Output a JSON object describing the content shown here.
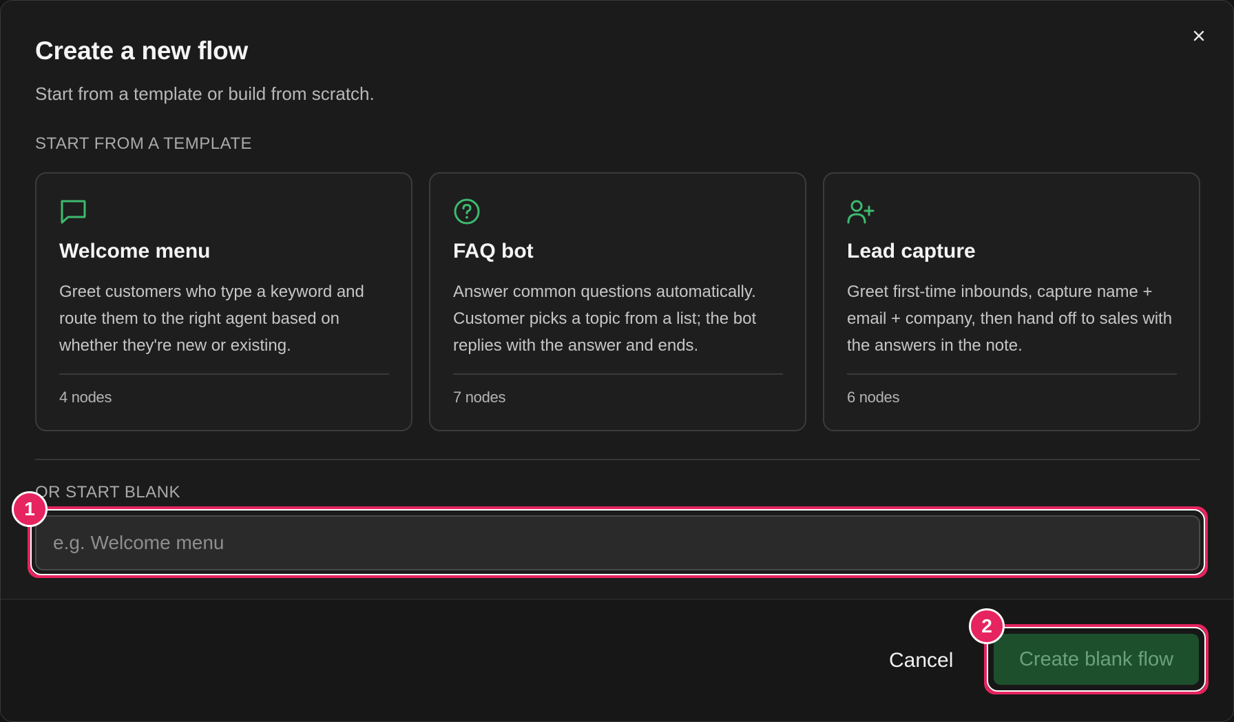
{
  "dialog": {
    "title": "Create a new flow",
    "subtitle": "Start from a template or build from scratch.",
    "close_icon": "close-icon"
  },
  "templates": {
    "section_label": "START FROM A TEMPLATE",
    "accent_color": "#3dbb6e",
    "cards": [
      {
        "icon": "message-square-icon",
        "name": "Welcome menu",
        "description": "Greet customers who type a keyword and route them to the right agent based on whether they're new or existing.",
        "nodes": "4 nodes"
      },
      {
        "icon": "help-circle-icon",
        "name": "FAQ bot",
        "description": "Answer common questions automatically. Customer picks a topic from a list; the bot replies with the answer and ends.",
        "nodes": "7 nodes"
      },
      {
        "icon": "user-plus-icon",
        "name": "Lead capture",
        "description": "Greet first-time inbounds, capture name + email + company, then hand off to sales with the answers in the note.",
        "nodes": "6 nodes"
      }
    ]
  },
  "blank": {
    "section_label": "OR START BLANK",
    "input_value": "",
    "input_placeholder": "e.g. Welcome menu"
  },
  "footer": {
    "cancel_label": "Cancel",
    "create_label": "Create blank flow"
  },
  "annotations": {
    "highlight_color": "#e6245f",
    "badges": [
      "1",
      "2"
    ]
  }
}
